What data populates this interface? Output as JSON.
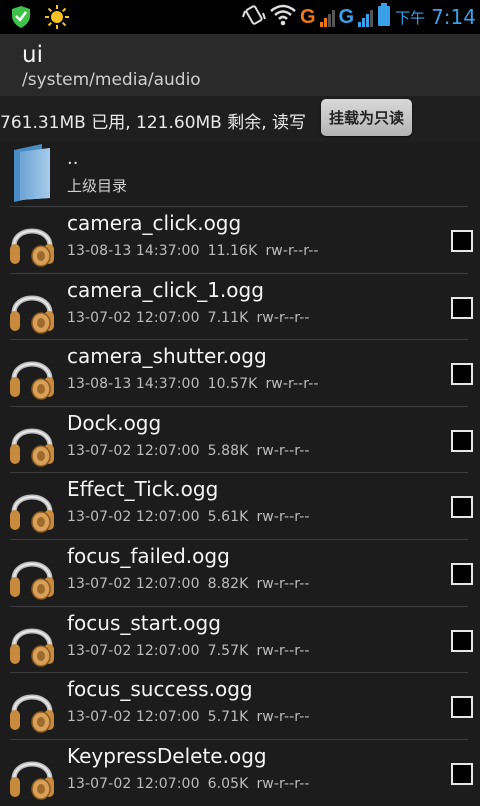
{
  "status_bar": {
    "ampm": "下午",
    "time": "7:14",
    "network_1": "G",
    "network_2": "G",
    "icons": [
      "shield-icon",
      "brightness-icon",
      "vibrate-icon",
      "wifi-icon",
      "battery-icon"
    ],
    "accent_color": "#3aa0e8",
    "warning_color": "#f07818"
  },
  "header": {
    "title": "ui",
    "path": "/system/media/audio"
  },
  "storage": {
    "info": "761.31MB 已用, 121.60MB 剩余, 读写",
    "mount_button": "挂载为只读"
  },
  "parent": {
    "dots": "..",
    "label": "上级目录"
  },
  "files": [
    {
      "name": "camera_click.ogg",
      "date": "13-08-13 14:37:00",
      "size": "11.16K",
      "perm": "rw-r--r--"
    },
    {
      "name": "camera_click_1.ogg",
      "date": "13-07-02 12:07:00",
      "size": "7.11K",
      "perm": "rw-r--r--"
    },
    {
      "name": "camera_shutter.ogg",
      "date": "13-08-13 14:37:00",
      "size": "10.57K",
      "perm": "rw-r--r--"
    },
    {
      "name": "Dock.ogg",
      "date": "13-07-02 12:07:00",
      "size": "5.88K",
      "perm": "rw-r--r--"
    },
    {
      "name": "Effect_Tick.ogg",
      "date": "13-07-02 12:07:00",
      "size": "5.61K",
      "perm": "rw-r--r--"
    },
    {
      "name": "focus_failed.ogg",
      "date": "13-07-02 12:07:00",
      "size": "8.82K",
      "perm": "rw-r--r--"
    },
    {
      "name": "focus_start.ogg",
      "date": "13-07-02 12:07:00",
      "size": "7.57K",
      "perm": "rw-r--r--"
    },
    {
      "name": "focus_success.ogg",
      "date": "13-07-02 12:07:00",
      "size": "5.71K",
      "perm": "rw-r--r--"
    },
    {
      "name": "KeypressDelete.ogg",
      "date": "13-07-02 12:07:00",
      "size": "6.05K",
      "perm": "rw-r--r--"
    }
  ]
}
